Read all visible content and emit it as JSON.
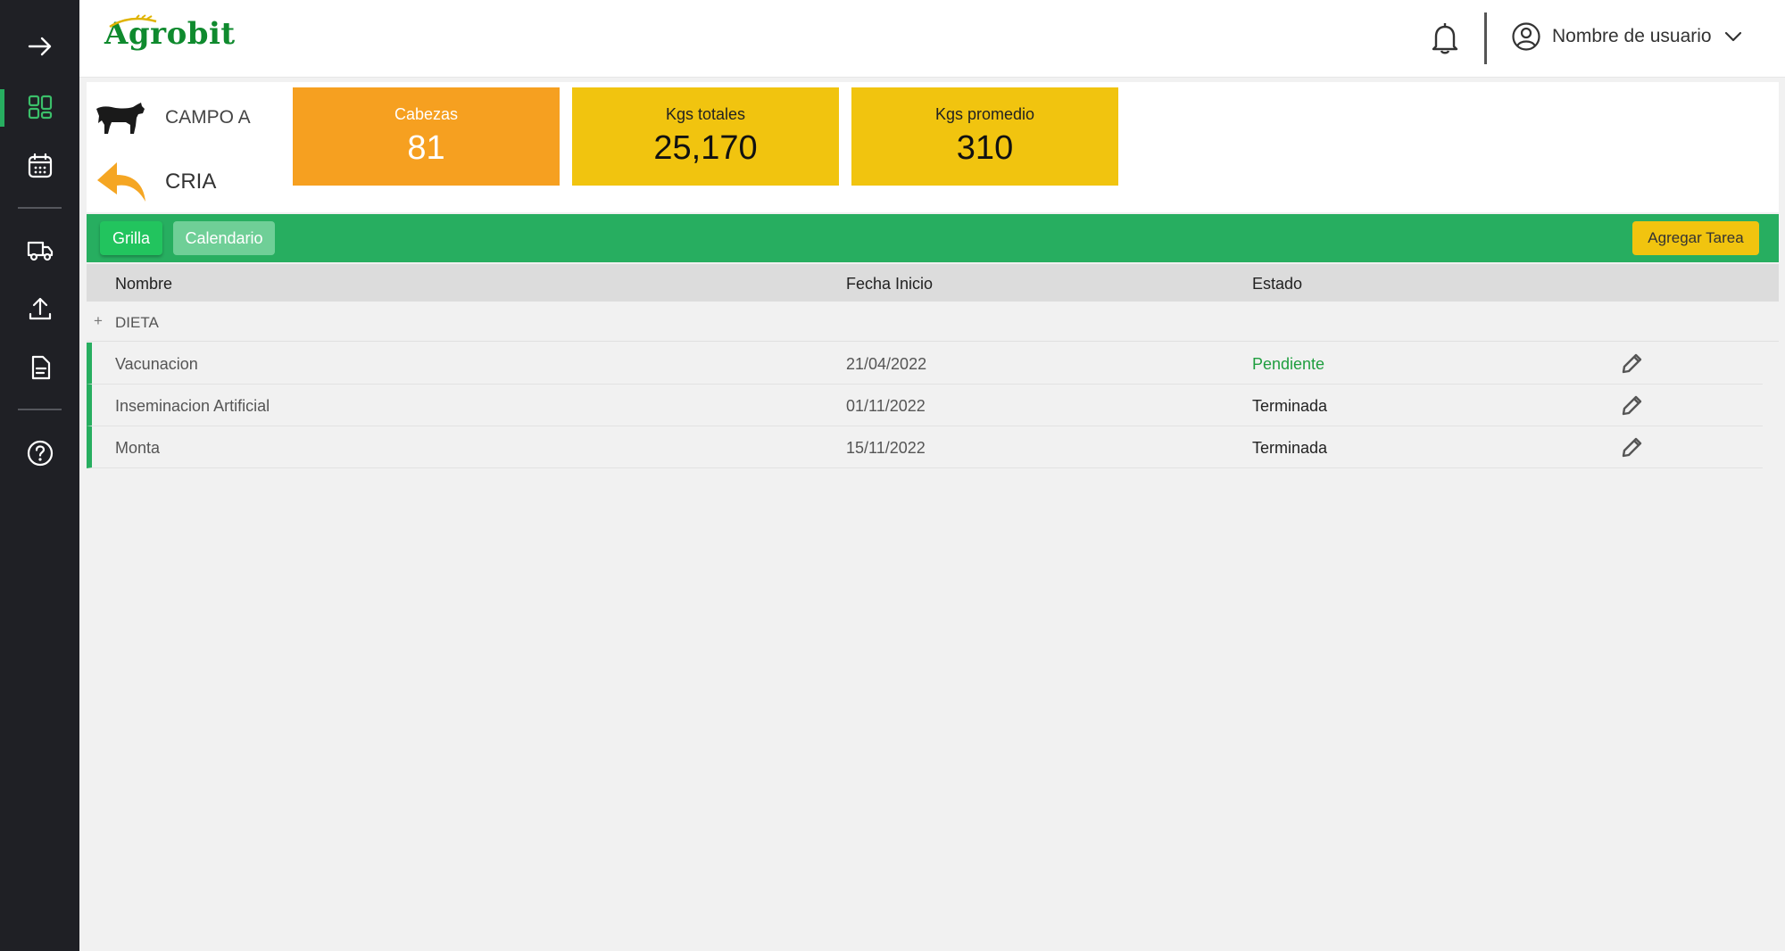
{
  "brand": {
    "name": "Agrobit"
  },
  "sidebar": {
    "items": [
      {
        "name": "toggle-arrow",
        "icon": "arrow-right-icon"
      },
      {
        "name": "dashboard",
        "icon": "grid-icon",
        "active": true
      },
      {
        "name": "calendar",
        "icon": "calendar-icon"
      },
      {
        "name": "transport",
        "icon": "truck-icon"
      },
      {
        "name": "upload",
        "icon": "upload-icon"
      },
      {
        "name": "documents",
        "icon": "document-icon"
      },
      {
        "name": "help",
        "icon": "help-icon"
      }
    ]
  },
  "header": {
    "user_name": "Nombre de usuario"
  },
  "campo": {
    "name": "CAMPO A",
    "activity": "CRIA"
  },
  "stats": [
    {
      "label": "Cabezas",
      "value": "81",
      "color": "#f6a020"
    },
    {
      "label": "Kgs totales",
      "value": "25,170",
      "color": "#f1c40f"
    },
    {
      "label": "Kgs promedio",
      "value": "310",
      "color": "#f1c40f"
    }
  ],
  "tabs": [
    {
      "label": "Grilla",
      "active": true
    },
    {
      "label": "Calendario",
      "active": false
    }
  ],
  "add_button": "Agregar Tarea",
  "table": {
    "headers": {
      "nombre": "Nombre",
      "fecha": "Fecha Inicio",
      "estado": "Estado"
    },
    "group": {
      "toggle": "+",
      "label": "DIETA"
    },
    "rows": [
      {
        "nombre": "Vacunacion",
        "fecha": "21/04/2022",
        "estado": "Pendiente"
      },
      {
        "nombre": "Inseminacion Artificial",
        "fecha": "01/11/2022",
        "estado": "Terminada"
      },
      {
        "nombre": "Monta",
        "fecha": "15/11/2022",
        "estado": "Terminada"
      }
    ]
  },
  "colors": {
    "sidebar": "#1f2025",
    "accent_green": "#27ae60",
    "pending": "#1f9e3f"
  }
}
